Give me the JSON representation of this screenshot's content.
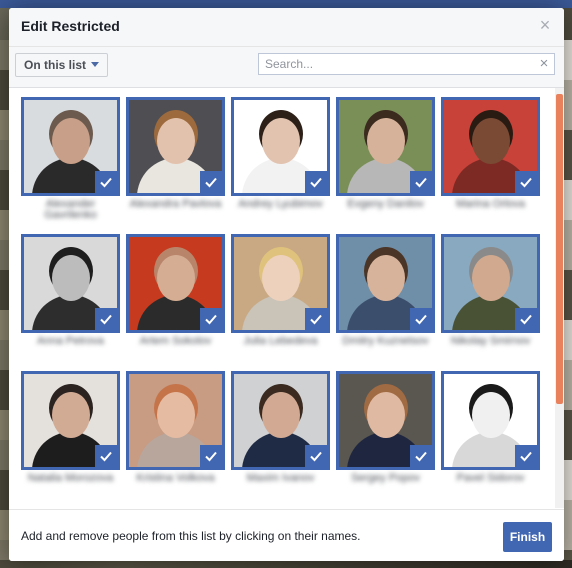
{
  "dialog": {
    "title": "Edit Restricted",
    "close_icon": "close-icon",
    "filter_label": "On this list",
    "search_placeholder": "Search...",
    "hint": "Add and remove people from this list by clicking on their names.",
    "finish_label": "Finish"
  },
  "colors": {
    "accent": "#4267b2",
    "scroll_thumb": "#e9825c"
  },
  "people": [
    {
      "name": "Alexander Gavrilenko",
      "selected": true,
      "bg": "#d9dcdf",
      "skin": "#c89f88",
      "hair": "#6b5a4d",
      "shirt": "#2a2a2a"
    },
    {
      "name": "Alexandra Pavlova",
      "selected": true,
      "bg": "#4f4e52",
      "skin": "#e3c2ad",
      "hair": "#9c6a3d",
      "shirt": "#e9e6df"
    },
    {
      "name": "Andrey Lyubimov",
      "selected": true,
      "bg": "#ffffff",
      "skin": "#e2c3b0",
      "hair": "#2d2018",
      "shirt": "#f2f2f2"
    },
    {
      "name": "Evgeny Danilov",
      "selected": true,
      "bg": "#7a8f58",
      "skin": "#d7b29a",
      "hair": "#3b2a1e",
      "shirt": "#b7b7b7"
    },
    {
      "name": "Marina Orlova",
      "selected": true,
      "bg": "#c9423a",
      "skin": "#7a4a34",
      "hair": "#2a1b12",
      "shirt": "#7d2a25"
    },
    {
      "name": "Anna Petrova",
      "selected": true,
      "bg": "#d9d9d9",
      "skin": "#bcbcbc",
      "hair": "#1e1e1e",
      "shirt": "#2d2d2d"
    },
    {
      "name": "Artem Sokolov",
      "selected": true,
      "bg": "#c63a1f",
      "skin": "#d4ad93",
      "hair": "#b8856a",
      "shirt": "#2b2b2b"
    },
    {
      "name": "Julia Lebedeva",
      "selected": true,
      "bg": "#c8a983",
      "skin": "#edd1bd",
      "hair": "#dfc27b",
      "shirt": "#c9c3b8"
    },
    {
      "name": "Dmitry Kuznetsov",
      "selected": true,
      "bg": "#6f8ea8",
      "skin": "#d8b39b",
      "hair": "#4b3526",
      "shirt": "#3b4e6b"
    },
    {
      "name": "Nikolay Smirnov",
      "selected": true,
      "bg": "#88a9bf",
      "skin": "#d1a98e",
      "hair": "#8a8a8a",
      "shirt": "#4a5236"
    },
    {
      "name": "Natalia Morozova",
      "selected": true,
      "bg": "#e4e1dc",
      "skin": "#d2ab95",
      "hair": "#2b2320",
      "shirt": "#1d1d1d"
    },
    {
      "name": "Kristina Volkova",
      "selected": true,
      "bg": "#c89b83",
      "skin": "#e5bba2",
      "hair": "#c5744a",
      "shirt": "#b8a69c"
    },
    {
      "name": "Maxim Ivanov",
      "selected": true,
      "bg": "#cfd1d3",
      "skin": "#d2aa93",
      "hair": "#3a2a20",
      "shirt": "#1f2b45"
    },
    {
      "name": "Sergey Popov",
      "selected": true,
      "bg": "#5a5750",
      "skin": "#e0b9a2",
      "hair": "#a06a42",
      "shirt": "#1f2740"
    },
    {
      "name": "Pavel Sidorov",
      "selected": true,
      "bg": "#ffffff",
      "skin": "#f0f0f0",
      "hair": "#1a1a1a",
      "shirt": "#d8d8d8"
    }
  ]
}
